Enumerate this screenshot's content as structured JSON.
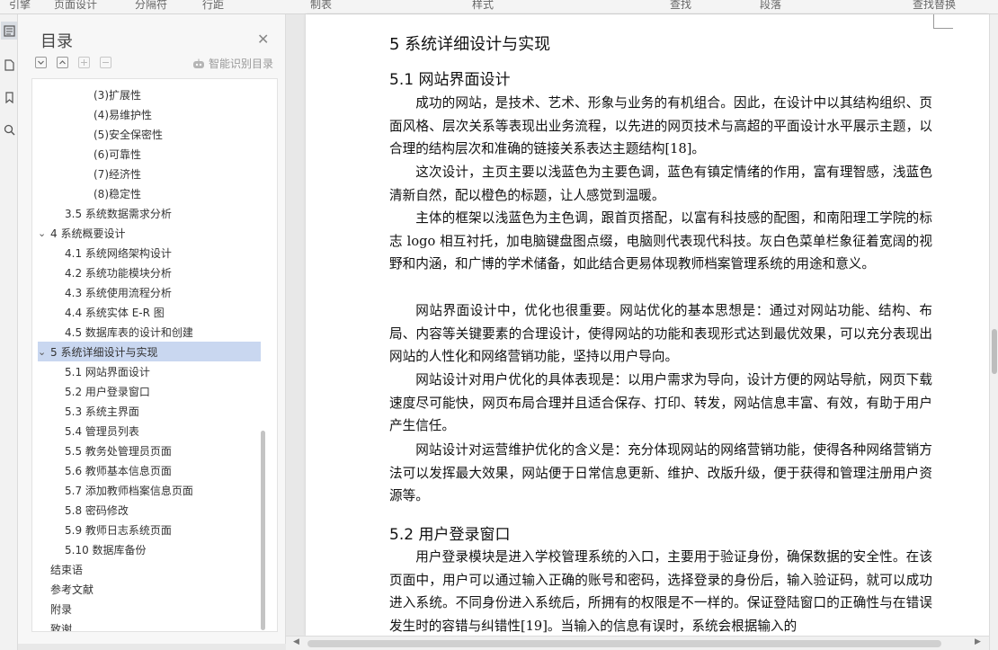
{
  "toolbar": {
    "fragments": [
      "引擎",
      "页面设计",
      "分隔符",
      "行距",
      "制表",
      "样式",
      "查找",
      "段落",
      "查找替换"
    ]
  },
  "panel": {
    "title": "目录",
    "smart_toc": "智能识别目录",
    "items": [
      {
        "label": "(3)扩展性",
        "level": 3
      },
      {
        "label": "(4)易维护性",
        "level": 3
      },
      {
        "label": "(5)安全保密性",
        "level": 3
      },
      {
        "label": "(6)可靠性",
        "level": 3
      },
      {
        "label": "(7)经济性",
        "level": 3
      },
      {
        "label": "(8)稳定性",
        "level": 3
      },
      {
        "label": "3.5 系统数据需求分析",
        "level": 2
      },
      {
        "label": "4 系统概要设计",
        "level": 1,
        "expand": "⌄"
      },
      {
        "label": "4.1 系统网络架构设计",
        "level": 2
      },
      {
        "label": "4.2 系统功能模块分析",
        "level": 2
      },
      {
        "label": "4.3 系统使用流程分析",
        "level": 2
      },
      {
        "label": "4.4 系统实体 E-R 图",
        "level": 2
      },
      {
        "label": "4.5 数据库表的设计和创建",
        "level": 2
      },
      {
        "label": "5 系统详细设计与实现",
        "level": 1,
        "expand": "⌄",
        "selected": true
      },
      {
        "label": "5.1 网站界面设计",
        "level": 2
      },
      {
        "label": "5.2 用户登录窗口",
        "level": 2
      },
      {
        "label": "5.3 系统主界面",
        "level": 2
      },
      {
        "label": "5.4 管理员列表",
        "level": 2
      },
      {
        "label": "5.5 教务处管理员页面",
        "level": 2
      },
      {
        "label": "5.6 教师基本信息页面",
        "level": 2
      },
      {
        "label": "5.7 添加教师档案信息页面",
        "level": 2
      },
      {
        "label": "5.8 密码修改",
        "level": 2
      },
      {
        "label": "5.9 教师日志系统页面",
        "level": 2
      },
      {
        "label": "5.10 数据库备份",
        "level": 2
      },
      {
        "label": "结束语",
        "level": 0
      },
      {
        "label": "参考文献",
        "level": 0
      },
      {
        "label": "附录",
        "level": 0
      },
      {
        "label": "致谢",
        "level": 0
      }
    ]
  },
  "document": {
    "heading_5": "5   系统详细设计与实现",
    "heading_5_1": "5.1   网站界面设计",
    "paragraphs_5_1": [
      "成功的网站，是技术、艺术、形象与业务的有机组合。因此，在设计中以其结构组织、页面风格、层次关系等表现出业务流程，以先进的网页技术与高超的平面设计水平展示主题，以合理的结构层次和准确的链接关系表达主题结构[18]。",
      "这次设计，主页主要以浅蓝色为主要色调，蓝色有镇定情绪的作用，富有理智感，浅蓝色清新自然，配以橙色的标题，让人感觉到温暖。",
      "主体的框架以浅蓝色为主色调，跟首页搭配，以富有科技感的配图，和南阳理工学院的标志 logo 相互衬托，加电脑键盘图点缀，电脑则代表现代科技。灰白色菜单栏象征着宽阔的视野和内涵，和广博的学术储备，如此结合更易体现教师档案管理系统的用途和意义。",
      "网站界面设计中，优化也很重要。网站优化的基本思想是：通过对网站功能、结构、布局、内容等关键要素的合理设计，使得网站的功能和表现形式达到最优效果，可以充分表现出网站的人性化和网络营销功能，坚持以用户导向。",
      "网站设计对用户优化的具体表现是：以用户需求为导向，设计方便的网站导航，网页下载速度尽可能快，网页布局合理并且适合保存、打印、转发，网站信息丰富、有效，有助于用户产生信任。",
      "网站设计对运营维护优化的含义是：充分体现网站的网络营销功能，使得各种网络营销方法可以发挥最大效果，网站便于日常信息更新、维护、改版升级，便于获得和管理注册用户资源等。"
    ],
    "heading_5_2": "5.2   用户登录窗口",
    "paragraphs_5_2": [
      "用户登录模块是进入学校管理系统的入口，主要用于验证身份，确保数据的安全性。在该页面中，用户可以通过输入正确的账号和密码，选择登录的身份后，输入验证码，就可以成功进入系统。不同身份进入系统后，所拥有的权限是不一样的。保证登陆窗口的正确性与在错误发生时的容错与纠错性[19]。当输入的信息有误时，系统会根据输入的"
    ]
  },
  "icons": {
    "rail": [
      "toc-icon",
      "bookmark-icon",
      "page-icon",
      "search-icon"
    ]
  }
}
